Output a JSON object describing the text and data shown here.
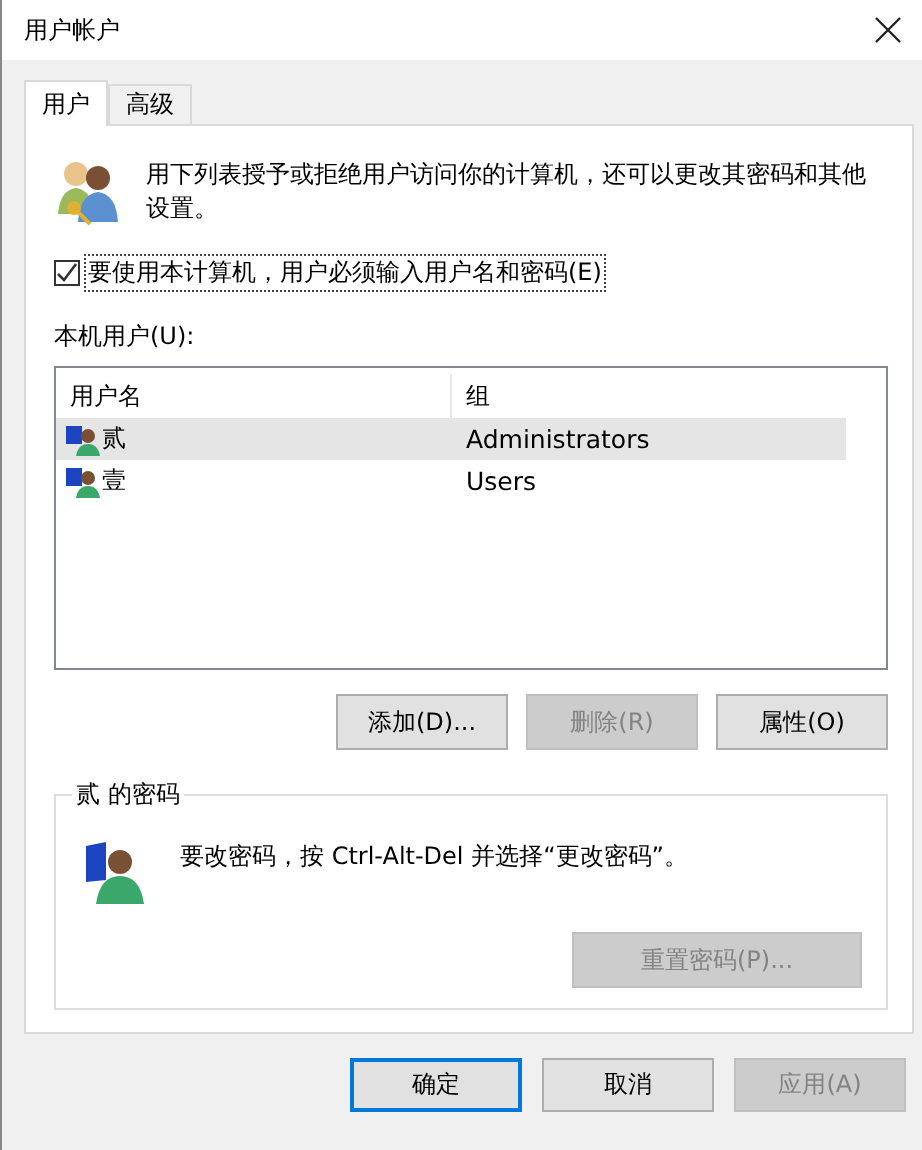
{
  "window": {
    "title": "用户帐户"
  },
  "tabs": [
    {
      "label": "用户",
      "selected": true
    },
    {
      "label": "高级",
      "selected": false
    }
  ],
  "description": "用下列表授予或拒绝用户访问你的计算机，还可以更改其密码和其他设置。",
  "require_password": {
    "label": "要使用本计算机，用户必须输入用户名和密码(E)",
    "checked": true
  },
  "users_label": "本机用户(U):",
  "table": {
    "columns": [
      "用户名",
      "组"
    ],
    "rows": [
      {
        "name": "贰",
        "group": "Administrators",
        "selected": true
      },
      {
        "name": "壹",
        "group": "Users",
        "selected": false
      }
    ]
  },
  "user_buttons": [
    {
      "label": "添加(D)...",
      "disabled": false
    },
    {
      "label": "删除(R)",
      "disabled": true
    },
    {
      "label": "属性(O)",
      "disabled": false
    }
  ],
  "password_group": {
    "title": "贰 的密码",
    "text": "要改密码，按 Ctrl-Alt-Del 并选择“更改密码”。",
    "reset_button": {
      "label": "重置密码(P)...",
      "disabled": true
    }
  },
  "dialog_buttons": [
    {
      "label": "确定",
      "default": true,
      "disabled": false
    },
    {
      "label": "取消",
      "default": false,
      "disabled": false
    },
    {
      "label": "应用(A)",
      "default": false,
      "disabled": true
    }
  ]
}
